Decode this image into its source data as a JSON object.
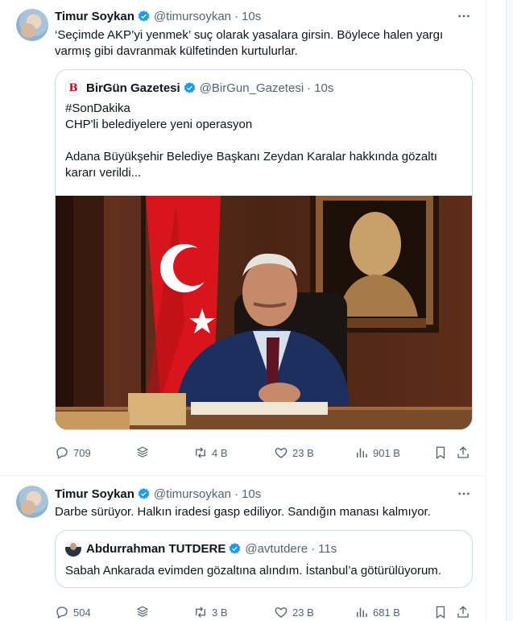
{
  "tweets": [
    {
      "author": "Timur Soykan",
      "handle": "@timursoykan",
      "separator": "·",
      "time": "10s",
      "text": "‘Seçimde AKP’yi yenmek’ suç olarak yasalara girsin. Böylece halen yargı varmış gibi davranmak külfetinden kurtulurlar.",
      "quote": {
        "author": "BirGün Gazetesi",
        "handle": "@BirGun_Gazetesi",
        "separator": "·",
        "time": "10s",
        "lines": [
          "#SonDakika",
          "CHP'li belediyelere yeni operasyon",
          "",
          "Adana Büyükşehir Belediye Başkanı Zeydan Karalar hakkında gözaltı kararı verildi..."
        ]
      },
      "stats": {
        "replies": "709",
        "retweets": "4 B",
        "likes": "23 B",
        "views": "901 B"
      }
    },
    {
      "author": "Timur Soykan",
      "handle": "@timursoykan",
      "separator": "·",
      "time": "10s",
      "text": "Darbe sürüyor. Halkın iradesi gasp ediliyor. Sandığın manası kalmıyor.",
      "quote": {
        "author": "Abdurrahman TUTDERE",
        "handle": "@avtutdere",
        "separator": "·",
        "time": "11s",
        "lines": [
          "Sabah Ankarada evimden gözaltına alındım. İstanbul’a götürülüyorum."
        ]
      },
      "stats": {
        "replies": "504",
        "retweets": "3 B",
        "likes": "23 B",
        "views": "681 B"
      }
    }
  ],
  "icons": {
    "verified": "verified-badge-icon",
    "more": "more-dots-icon",
    "reply": "reply-icon",
    "grok": "grok-icon",
    "retweet": "retweet-icon",
    "like": "like-icon",
    "views": "views-icon",
    "bookmark": "bookmark-icon",
    "share": "share-icon"
  },
  "colors": {
    "verified": "#1d9bf0",
    "secondary_text": "#536471",
    "border": "#cfd9de"
  }
}
